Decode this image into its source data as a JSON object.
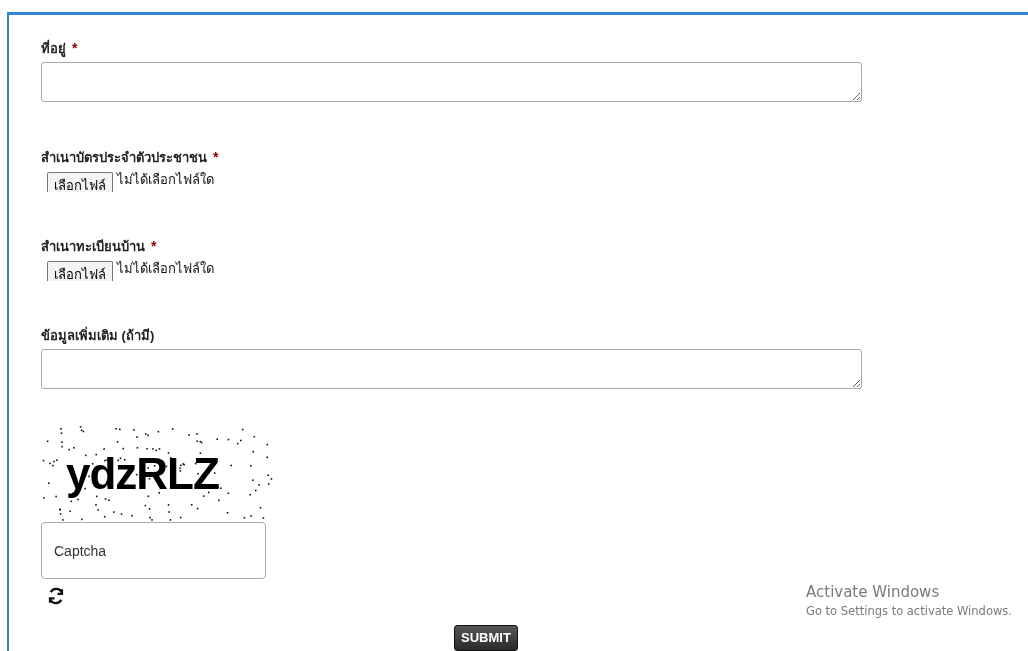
{
  "fields": [
    {
      "kind": "textarea",
      "label": "ที่อยู่",
      "marker": "*"
    },
    {
      "kind": "file",
      "label": "สำเนาบัตรประจำตัวประชาชน",
      "marker": "*",
      "button": "เลือกไฟล์",
      "status": "ไม่ได้เลือกไฟล์ใด"
    },
    {
      "kind": "file",
      "label": "สำเนาทะเบียนบ้าน",
      "marker": "*",
      "button": "เลือกไฟล์",
      "status": "ไม่ได้เลือกไฟล์ใด"
    },
    {
      "kind": "textarea",
      "label": "ข้อมูลเพิ่มเติม (ถ้ามี)"
    }
  ],
  "captcha": {
    "text": "ydzRLZ",
    "placeholder": "Captcha"
  },
  "submit": "SUBMIT",
  "os_overlay": {
    "title": "Activate Windows",
    "subtitle": "Go to Settings to activate Windows."
  }
}
